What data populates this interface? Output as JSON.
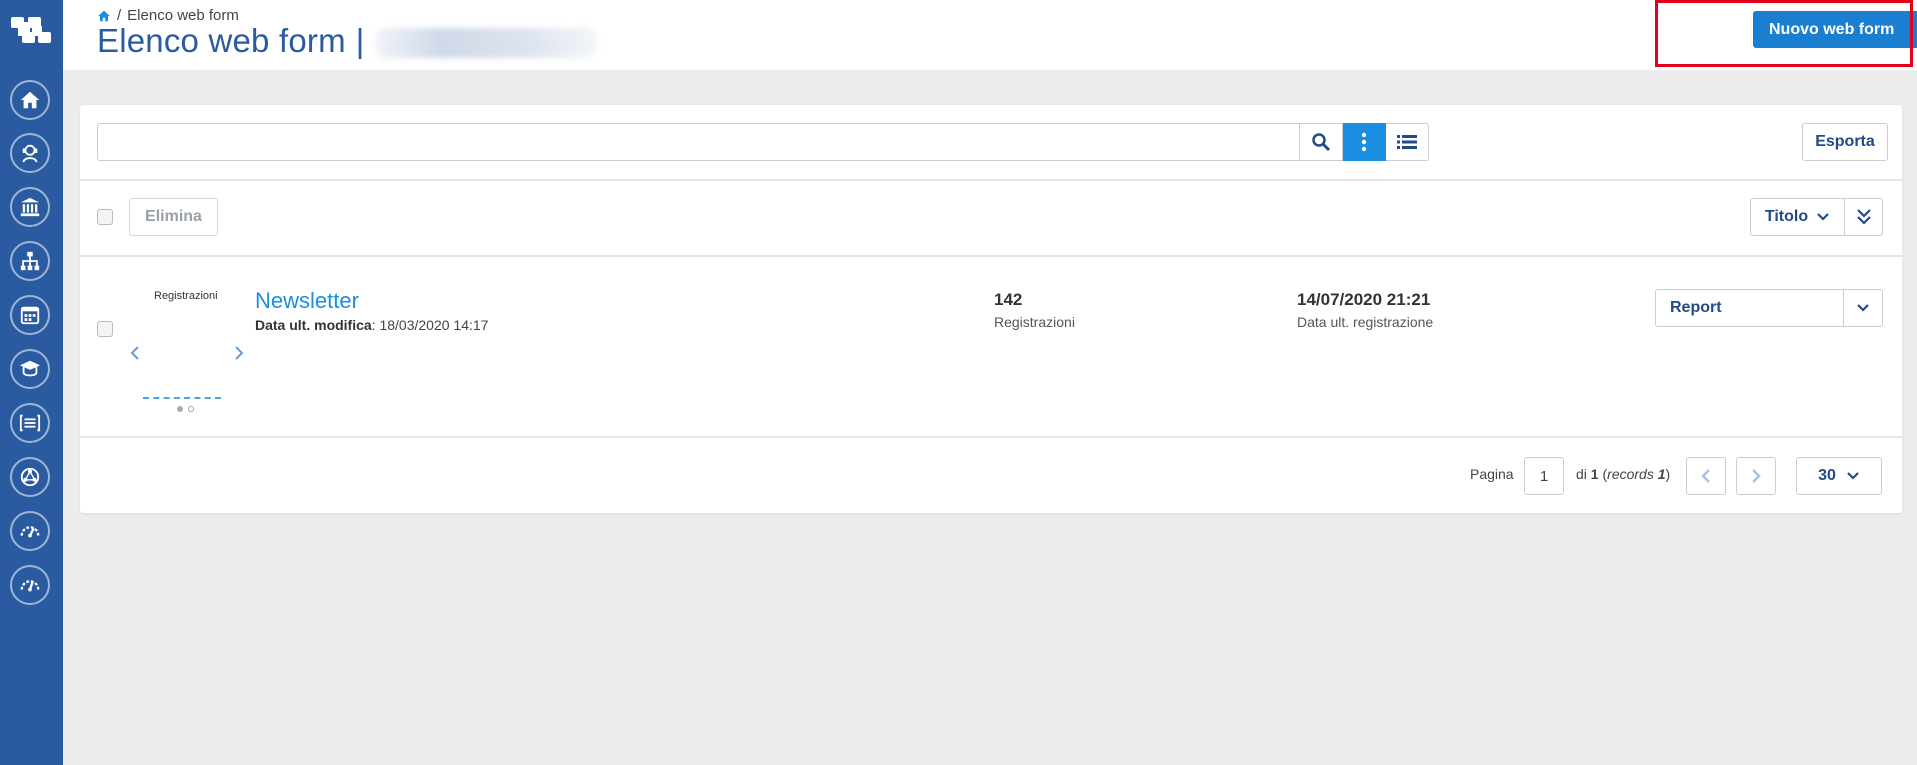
{
  "breadcrumb": {
    "current": "Elenco web form"
  },
  "header": {
    "title": "Elenco web form",
    "separator": "|",
    "new_button": "Nuovo web form"
  },
  "toolbar": {
    "search_value": "",
    "export_label": "Esporta"
  },
  "list_actions": {
    "delete_label": "Elimina",
    "sort_field": "Titolo"
  },
  "rows": [
    {
      "thumb_label": "Registrazioni",
      "title": "Newsletter",
      "modified_label": "Data ult. modifica",
      "modified_value": "18/03/2020 14:17",
      "registrations_count": "142",
      "registrations_label": "Registrazioni",
      "last_registration": "14/07/2020 21:21",
      "last_registration_label": "Data ult. registrazione",
      "action_label": "Report"
    }
  ],
  "pagination": {
    "page_label": "Pagina",
    "current_page": "1",
    "of_text": "di",
    "total_pages": "1",
    "records_label": "records",
    "records_count": "1",
    "per_page": "30"
  },
  "colors": {
    "sidebar": "#2a5ba0",
    "primary": "#1a7fd1",
    "link": "#1a8ee1",
    "highlight": "#e0001a"
  },
  "sidebar_icons": [
    "home-icon",
    "user-support-icon",
    "bank-icon",
    "sitemap-icon",
    "calendar-icon",
    "graduation-icon",
    "list-icon",
    "network-icon",
    "gauge-icon",
    "gauge-icon"
  ]
}
